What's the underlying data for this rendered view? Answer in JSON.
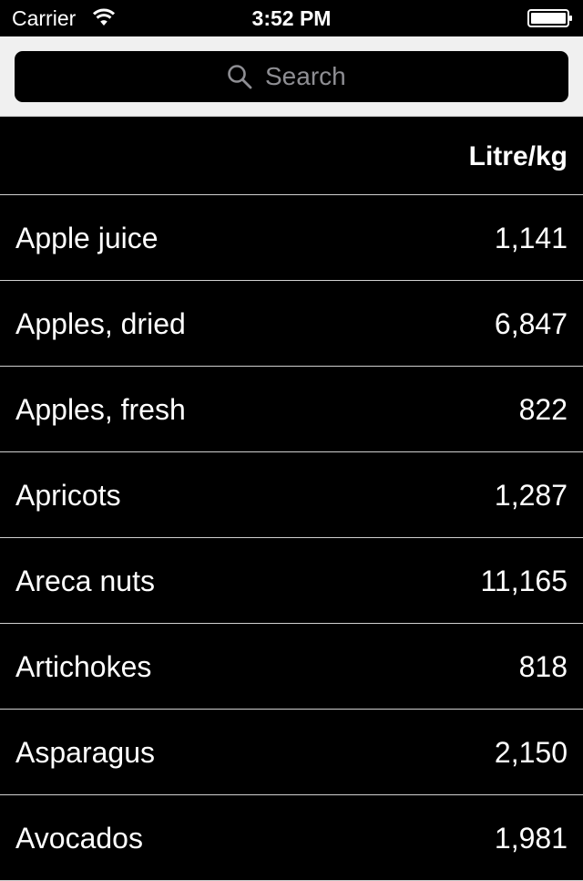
{
  "status_bar": {
    "carrier": "Carrier",
    "time": "3:52 PM",
    "wifi_icon": "wifi-icon",
    "battery_icon": "battery-icon"
  },
  "search": {
    "placeholder": "Search",
    "icon": "search-icon"
  },
  "table": {
    "unit_header": "Litre/kg",
    "rows": [
      {
        "name": "Apple juice",
        "value": "1,141"
      },
      {
        "name": "Apples, dried",
        "value": "6,847"
      },
      {
        "name": "Apples, fresh",
        "value": "822"
      },
      {
        "name": "Apricots",
        "value": "1,287"
      },
      {
        "name": "Areca nuts",
        "value": "11,165"
      },
      {
        "name": "Artichokes",
        "value": "818"
      },
      {
        "name": "Asparagus",
        "value": "2,150"
      },
      {
        "name": "Avocados",
        "value": "1,981"
      }
    ]
  },
  "colors": {
    "background": "#000000",
    "text": "#ffffff",
    "search_area": "#f0f0f0",
    "placeholder": "#8e8e93",
    "separator": "#d0d0d0"
  }
}
